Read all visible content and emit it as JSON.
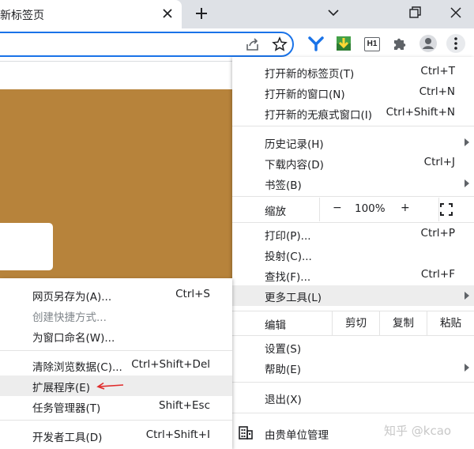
{
  "tab": {
    "title": "新标签页"
  },
  "colors": {
    "accent": "#1a73e8",
    "gold": "#b7833b",
    "highlight": "#ededed",
    "annotation": "#e02b2b"
  },
  "main_menu": {
    "items": [
      {
        "label": "打开新的标签页(T)",
        "shortcut": "Ctrl+T"
      },
      {
        "label": "打开新的窗口(N)",
        "shortcut": "Ctrl+N"
      },
      {
        "label": "打开新的无痕式窗口(I)",
        "shortcut": "Ctrl+Shift+N"
      },
      {
        "label": "历史记录(H)",
        "shortcut": ""
      },
      {
        "label": "下载内容(D)",
        "shortcut": "Ctrl+J"
      },
      {
        "label": "书签(B)",
        "shortcut": ""
      },
      {
        "label": "打印(P)...",
        "shortcut": "Ctrl+P"
      },
      {
        "label": "投射(C)...",
        "shortcut": ""
      },
      {
        "label": "查找(F)...",
        "shortcut": "Ctrl+F"
      },
      {
        "label": "更多工具(L)",
        "shortcut": ""
      },
      {
        "label": "设置(S)",
        "shortcut": ""
      },
      {
        "label": "帮助(E)",
        "shortcut": ""
      },
      {
        "label": "退出(X)",
        "shortcut": ""
      }
    ],
    "zoom": {
      "label": "缩放",
      "minus": "−",
      "value": "100%",
      "plus": "+"
    },
    "edit": {
      "label": "编辑",
      "cut": "剪切",
      "copy": "复制",
      "paste": "粘贴"
    },
    "managed": "由贵单位管理"
  },
  "sub_menu": {
    "items": [
      {
        "label": "网页另存为(A)...",
        "shortcut": "Ctrl+S"
      },
      {
        "label": "创建快捷方式...",
        "shortcut": ""
      },
      {
        "label": "为窗口命名(W)...",
        "shortcut": ""
      },
      {
        "label": "清除浏览数据(C)...",
        "shortcut": "Ctrl+Shift+Del"
      },
      {
        "label": "扩展程序(E)",
        "shortcut": ""
      },
      {
        "label": "任务管理器(T)",
        "shortcut": "Shift+Esc"
      },
      {
        "label": "开发者工具(D)",
        "shortcut": "Ctrl+Shift+I"
      }
    ]
  },
  "extensions": {
    "h1_badge": "H1"
  },
  "watermark": "知乎 @kcao"
}
